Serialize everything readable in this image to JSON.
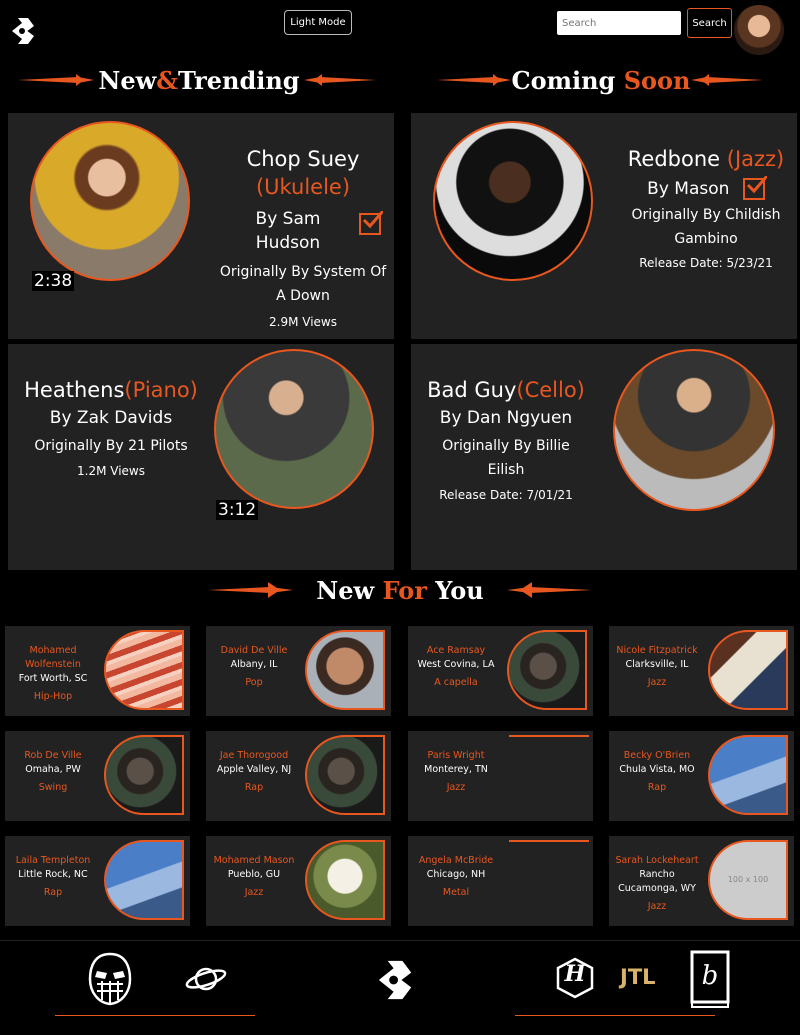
{
  "header": {
    "light_mode_label": "Light Mode",
    "search_placeholder": "Search",
    "search_button": "Search"
  },
  "sections": {
    "trending": {
      "part1": "New",
      "amp": "&",
      "part2": "Trending"
    },
    "coming": {
      "part1": "Coming",
      "part2": "Soon"
    },
    "for_you": {
      "part1": "New",
      "part2": "For",
      "part3": "You"
    }
  },
  "trending_cards": [
    {
      "title": "Chop Suey",
      "instrument": "(Ukulele)",
      "by": "By Sam Hudson",
      "original": "Originally By System Of A Down",
      "views": "2.9M Views",
      "duration": "2:38"
    },
    {
      "title": "Heathens",
      "instrument": "(Piano)",
      "by": "By Zak Davids",
      "original": "Originally By 21 Pilots",
      "views": "1.2M Views",
      "duration": "3:12"
    }
  ],
  "coming_cards": [
    {
      "title": "Redbone",
      "instrument": "(Jazz)",
      "by": "By Mason",
      "original": "Originally By Childish Gambino",
      "release": "Release Date: 5/23/21"
    },
    {
      "title": "Bad Guy",
      "instrument": "(Cello)",
      "by": "By Dan Ngyuen",
      "original": "Originally By Billie Eilish",
      "release": "Release Date: 7/01/21"
    }
  ],
  "artists": [
    {
      "name": "Mohamed Wolfenstein",
      "location": "Fort Worth, SC",
      "genre": "Hip-Hop",
      "image": "bacon"
    },
    {
      "name": "David De Ville",
      "location": "Albany, IL",
      "genre": "Pop",
      "image": "face"
    },
    {
      "name": "Ace Ramsay",
      "location": "West Covina, LA",
      "genre": "A capella",
      "image": "dog"
    },
    {
      "name": "Nicole Fitzpatrick",
      "location": "Clarksville, IL",
      "genre": "Jazz",
      "image": "book"
    },
    {
      "name": "Rob De Ville",
      "location": "Omaha, PW",
      "genre": "Swing",
      "image": "dog"
    },
    {
      "name": "Jae Thorogood",
      "location": "Apple Valley, NJ",
      "genre": "Rap",
      "image": "dog"
    },
    {
      "name": "Paris Wright",
      "location": "Monterey, TN",
      "genre": "Jazz",
      "image": "none"
    },
    {
      "name": "Becky O'Brien",
      "location": "Chula Vista, MO",
      "genre": "Rap",
      "image": "sky"
    },
    {
      "name": "Laila Templeton",
      "location": "Little Rock, NC",
      "genre": "Rap",
      "image": "sky"
    },
    {
      "name": "Mohamed Mason",
      "location": "Pueblo, GU",
      "genre": "Jazz",
      "image": "whitedog"
    },
    {
      "name": "Angela McBride",
      "location": "Chicago, NH",
      "genre": "Metal",
      "image": "none"
    },
    {
      "name": "Sarah Lockeheart",
      "location": "Rancho Cucamonga, WY",
      "genre": "Jazz",
      "image": "placeholder",
      "placeholder_text": "100 x 100"
    }
  ],
  "footer": {
    "jtl_text": "JTL",
    "h_text": "H",
    "b_text": "b"
  },
  "colors": {
    "accent": "#e8571f",
    "card": "#222222",
    "background": "#000000"
  }
}
